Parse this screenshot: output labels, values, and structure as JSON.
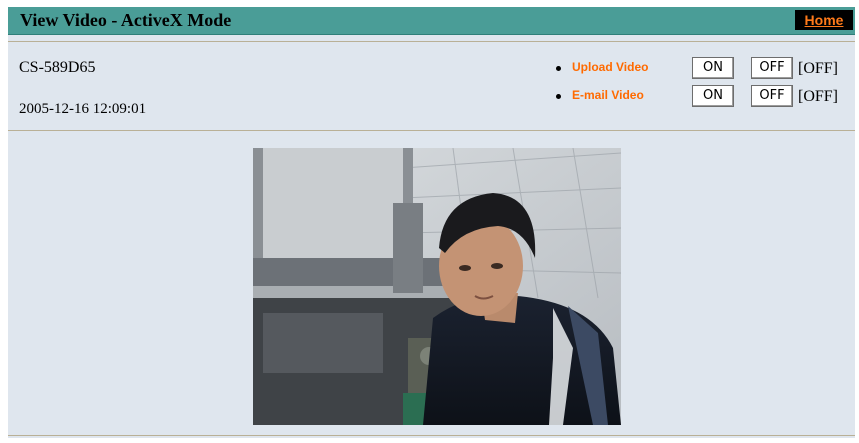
{
  "header": {
    "title": "View Video - ActiveX Mode",
    "home_link": "Home"
  },
  "device": {
    "name": "CS-589D65",
    "datetime": "2005-12-16 12:09:01"
  },
  "controls": [
    {
      "label": "Upload Video",
      "on_label": "ON",
      "off_label": "OFF",
      "state": "[OFF]"
    },
    {
      "label": "E-mail Video",
      "on_label": "ON",
      "off_label": "OFF",
      "state": "[OFF]"
    }
  ],
  "colors": {
    "title_bar": "#4a9d97",
    "panel_background": "#dfe6ee",
    "link_orange": "#ff6a00",
    "home_box": "#000000"
  }
}
